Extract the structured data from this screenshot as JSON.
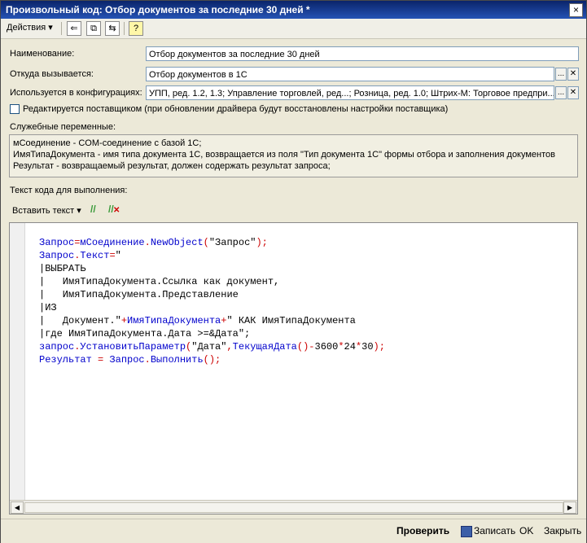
{
  "window": {
    "title": "Произвольный код: Отбор документов за последние 30 дней *",
    "close": "×"
  },
  "toolbar": {
    "actions": "Действия ▾",
    "icon1": "⇐",
    "icon2": "⧉",
    "icon3": "⇆",
    "help": "?"
  },
  "form": {
    "name_label": "Наименование:",
    "name_value": "Отбор документов за последние 30 дней",
    "call_label": "Откуда вызывается:",
    "call_value": "Отбор документов в 1С",
    "config_label": "Используется в конфигурациях:",
    "config_value": "УПП, ред. 1.2, 1.3; Управление торговлей, ред...; Розница, ред. 1.0; Штрих-М: Торговое предпри...",
    "ellipsis": "...",
    "clear": "✕",
    "vendor_checkbox_label": "Редактируется поставщиком (при обновлении драйвера будут восстановлены настройки поставщика)",
    "vendor_checked": false
  },
  "service_vars": {
    "label": "Служебные переменные:",
    "lines": [
      "мСоединение - COM-соединение с базой 1С;",
      "ИмяТипаДокумента - имя типа документа 1С, возвращается из поля \"Тип документа 1С\" формы отбора и заполнения документов",
      "Результат - возвращаемый результат, должен содержать результат запроса;"
    ]
  },
  "code": {
    "label": "Текст кода для выполнения:",
    "insert_text": "Вставить текст ▾",
    "comment_icon": "//",
    "uncomment_icon": "//"
  },
  "footer": {
    "check": "Проверить",
    "save": "Записать",
    "ok": "OK",
    "close": "Закрыть"
  }
}
